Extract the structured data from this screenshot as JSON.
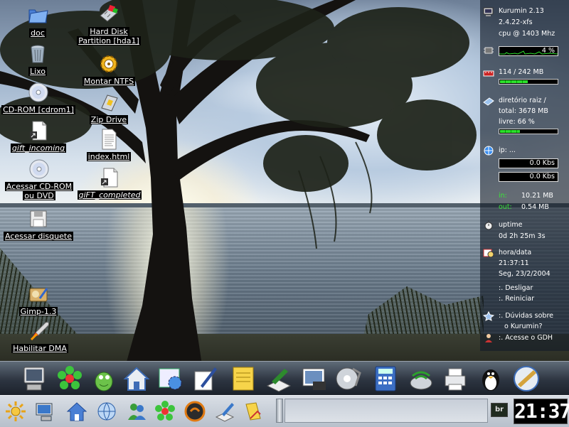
{
  "desktop": {
    "icons": [
      {
        "label": "doc",
        "icon": "folder-icon"
      },
      {
        "label": "Lixo",
        "icon": "trash-icon"
      },
      {
        "label": "CD-ROM [cdrom1]",
        "icon": "cdrom-icon"
      },
      {
        "label": "gift_incoming",
        "icon": "folder-link-icon"
      },
      {
        "label": "Acessar CD-ROM",
        "label2": "ou DVD",
        "icon": "cdrom-icon"
      },
      {
        "label": "Acessar disquete",
        "icon": "floppy-icon"
      },
      {
        "label": "Gimp-1.3",
        "icon": "gimp-icon"
      },
      {
        "label": "Habilitar DMA",
        "icon": "rocket-icon"
      },
      {
        "label": "Hard Disk",
        "label2": "Partition [hda1]",
        "icon": "harddisk-icon"
      },
      {
        "label": "Montar NTFS",
        "icon": "gear-icon"
      },
      {
        "label": "Zip Drive",
        "icon": "zip-icon"
      },
      {
        "label": "index.html",
        "icon": "document-icon"
      },
      {
        "label": "giFT_completed",
        "icon": "folder-link-icon"
      }
    ]
  },
  "monitor": {
    "system": {
      "line1": "Kurumin 2.13",
      "line2": "2.4.22-xfs",
      "line3": "cpu @ 1403 Mhz"
    },
    "cpu": {
      "value": "4 %",
      "percent": 4
    },
    "memory": {
      "text": "114 / 242 MB",
      "percent": 47
    },
    "disk": {
      "line1": "diretório raiz /",
      "line2": "total: 3678 MB",
      "line3": "livre: 66 %",
      "percent": 34
    },
    "network": {
      "ip": "ip: ...",
      "down": "0.0 Kbs",
      "up": "0.0 Kbs",
      "in_label": "in:",
      "in_value": "10.21 MB",
      "out_label": "out:",
      "out_value": "0.54 MB"
    },
    "uptime": {
      "label": "uptime",
      "value": "0d 2h 25m 3s"
    },
    "datetime": {
      "label": "hora/data",
      "time": "21:37:11",
      "date": "Seg, 23/2/2004"
    },
    "actions": {
      "shutdown": ":. Desligar",
      "restart": ":. Reiniciar"
    },
    "help": {
      "line1": ":. Dúvidas sobre",
      "line2": "o Kurumin?",
      "gdh": ":. Acesse o GDH"
    }
  },
  "dock": {
    "items": [
      "computer-icon",
      "icq-flower-icon",
      "gaim-icon",
      "home-icon",
      "settings-icon",
      "text-editor-icon",
      "office-icon",
      "book-icon",
      "photo-icon",
      "media-icon",
      "calculator-icon",
      "network-icon",
      "printer-icon",
      "tux-icon",
      "video-icon"
    ]
  },
  "kicker": {
    "buttons": [
      "kmenu-icon",
      "desktop-icon",
      "home-icon",
      "browser-icon",
      "messenger-icon",
      "icq-flower-icon",
      "audio-player-icon",
      "text-editor-icon",
      "office-icon"
    ],
    "keyboard_layout": "br",
    "clock": "21:37"
  },
  "colors": {
    "panel_bg": "#b7c0cb",
    "bar_fill": "#2ddf2d",
    "monitor_text": "#ffffff"
  }
}
